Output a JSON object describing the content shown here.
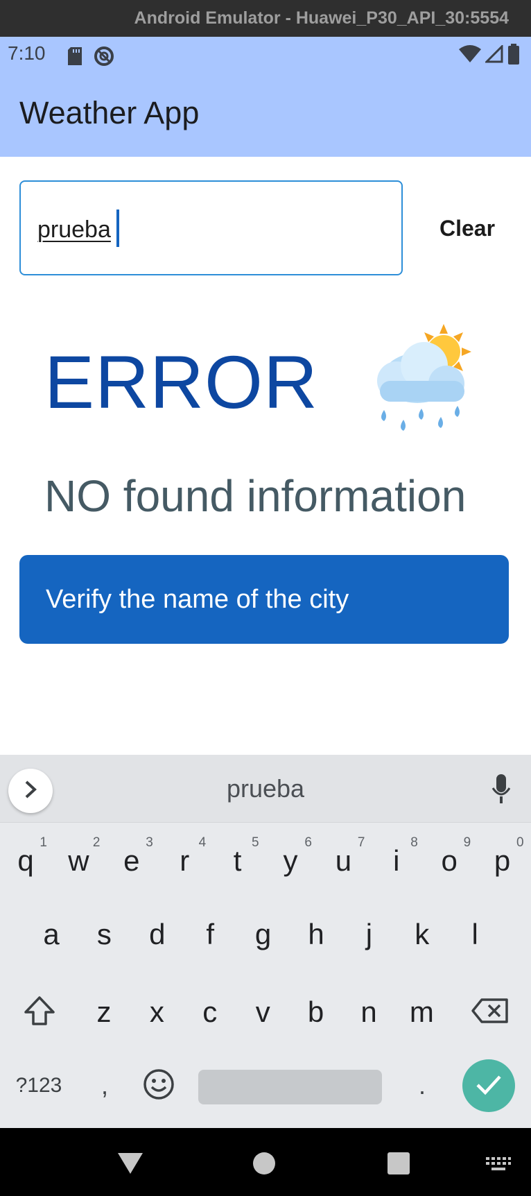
{
  "window": {
    "title": "Android Emulator - Huawei_P30_API_30:5554"
  },
  "status_bar": {
    "time": "7:10"
  },
  "app": {
    "title": "Weather App"
  },
  "search": {
    "value": "prueba",
    "clear_label": "Clear"
  },
  "result": {
    "error_title": "ERROR",
    "message": "NO found information",
    "weather_icon": "sun-behind-rain-cloud"
  },
  "snackbar": {
    "text": "Verify the name of the city"
  },
  "keyboard": {
    "suggestion": "prueba",
    "row1": [
      {
        "k": "q",
        "h": "1"
      },
      {
        "k": "w",
        "h": "2"
      },
      {
        "k": "e",
        "h": "3"
      },
      {
        "k": "r",
        "h": "4"
      },
      {
        "k": "t",
        "h": "5"
      },
      {
        "k": "y",
        "h": "6"
      },
      {
        "k": "u",
        "h": "7"
      },
      {
        "k": "i",
        "h": "8"
      },
      {
        "k": "o",
        "h": "9"
      },
      {
        "k": "p",
        "h": "0"
      }
    ],
    "row2": [
      "a",
      "s",
      "d",
      "f",
      "g",
      "h",
      "j",
      "k",
      "l"
    ],
    "row3": [
      "z",
      "x",
      "c",
      "v",
      "b",
      "n",
      "m"
    ],
    "symbols_label": "?123",
    "comma": ",",
    "period": "."
  },
  "colors": {
    "header": "#a9c6ff",
    "accent": "#1565c0",
    "error_text": "#0d47a1",
    "message_text": "#455a64",
    "enter_key": "#4db6a5"
  }
}
